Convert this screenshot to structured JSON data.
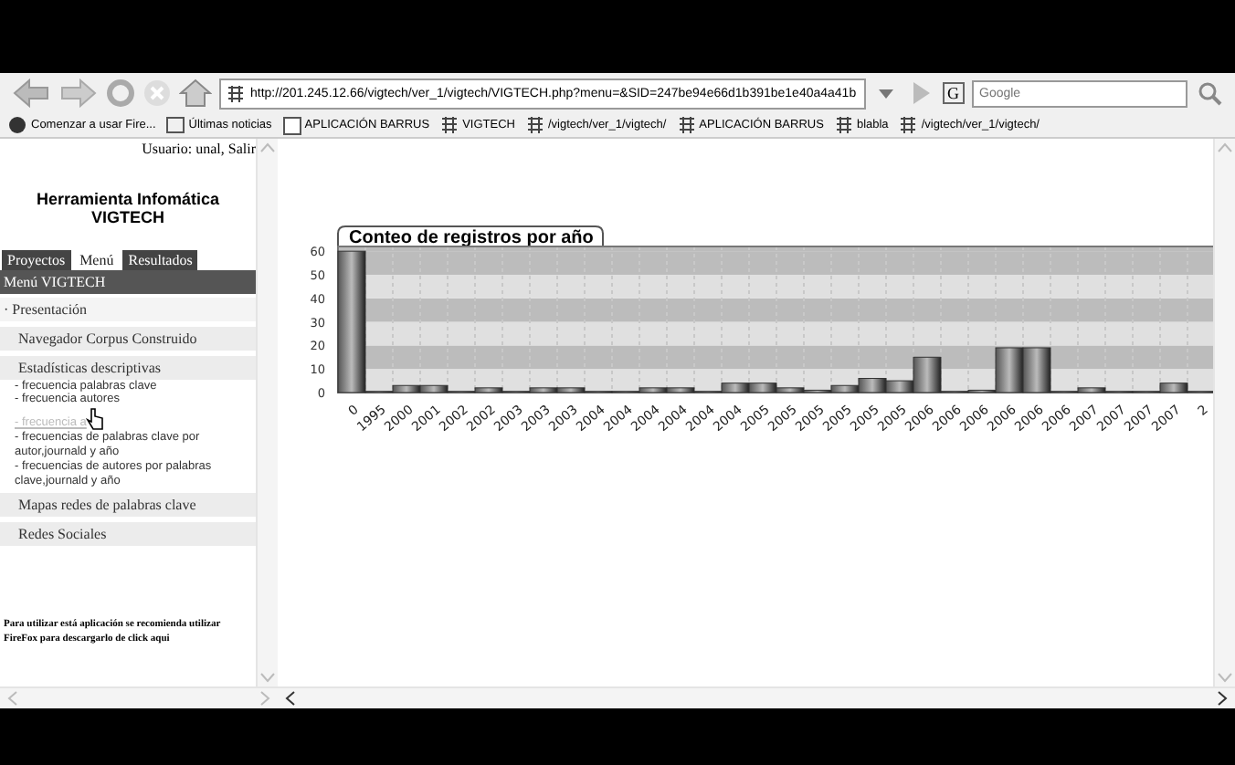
{
  "browser": {
    "url": "http://201.245.12.66/vigtech/ver_1/vigtech/VIGTECH.php?menu=&SID=247be94e66d1b391be1e40a4a41b",
    "search_placeholder": "Google",
    "search_engine": "G",
    "bookmarks": [
      {
        "label": "Comenzar a usar Fire...",
        "kind": "firefox"
      },
      {
        "label": "Últimas noticias",
        "kind": "rss"
      },
      {
        "label": "APLICACIÓN BARRUS",
        "kind": "google"
      },
      {
        "label": "VIGTECH",
        "kind": "page"
      },
      {
        "label": "/vigtech/ver_1/vigtech/",
        "kind": "page"
      },
      {
        "label": "APLICACIÓN BARRUS",
        "kind": "page"
      },
      {
        "label": "blabla",
        "kind": "page"
      },
      {
        "label": "/vigtech/ver_1/vigtech/",
        "kind": "page"
      }
    ]
  },
  "sidebar": {
    "user": "Usuario: unal, Salir",
    "title": "Herramienta Infomática VIGTECH",
    "tabs": [
      {
        "label": "Proyectos",
        "selected": false
      },
      {
        "label": "Menú",
        "selected": true
      },
      {
        "label": "Resultados",
        "selected": false
      }
    ],
    "menu_title": "Menú VIGTECH",
    "items": [
      {
        "kind": "bullet",
        "label": "· Presentación"
      },
      {
        "kind": "section",
        "label": "Navegador Corpus Construido"
      },
      {
        "kind": "section",
        "label": "Estadísticas descriptivas"
      },
      {
        "kind": "link",
        "label": "- frecuencia palabras clave",
        "hovered": false
      },
      {
        "kind": "link",
        "label": "- frecuencia autores",
        "hovered": false
      },
      {
        "kind": "link",
        "label": "- frecuencia a",
        "hovered": true
      },
      {
        "kind": "link",
        "label": "- frecuencias de palabras clave por autor,journald y año",
        "hovered": false
      },
      {
        "kind": "link",
        "label": "- frecuencias de autores por palabras clave,journald y año",
        "hovered": false
      },
      {
        "kind": "section",
        "label": "Mapas redes de palabras clave"
      },
      {
        "kind": "section",
        "label": "Redes Sociales"
      }
    ],
    "note": "Para utilizar está aplicación se recomienda utilizar FireFox para descargarlo de click aqui"
  },
  "main": {
    "chart_data": {
      "type": "bar",
      "title": "Conteo de registros por año",
      "categories": [
        "0",
        "1995",
        "2000",
        "2001",
        "2002",
        "2002",
        "2003",
        "2003",
        "2003",
        "2004",
        "2004",
        "2004",
        "2004",
        "2004",
        "2004",
        "2005",
        "2005",
        "2005",
        "2005",
        "2005",
        "2005",
        "2006",
        "2006",
        "2006",
        "2006",
        "2006",
        "2006",
        "2007",
        "2007",
        "2007",
        "2007",
        "2"
      ],
      "values": [
        60,
        0.5,
        3,
        3,
        0.5,
        2,
        0.5,
        2,
        2,
        0.5,
        0.5,
        2,
        2,
        0.5,
        4,
        4,
        2,
        1,
        3,
        6,
        5,
        15,
        0.5,
        1,
        19,
        19,
        0.5,
        2,
        0.5,
        0.5,
        4,
        0.5
      ],
      "ylim": [
        0,
        62
      ],
      "grid": true,
      "yticks": [
        0,
        10,
        20,
        30,
        40,
        50,
        60
      ]
    }
  }
}
